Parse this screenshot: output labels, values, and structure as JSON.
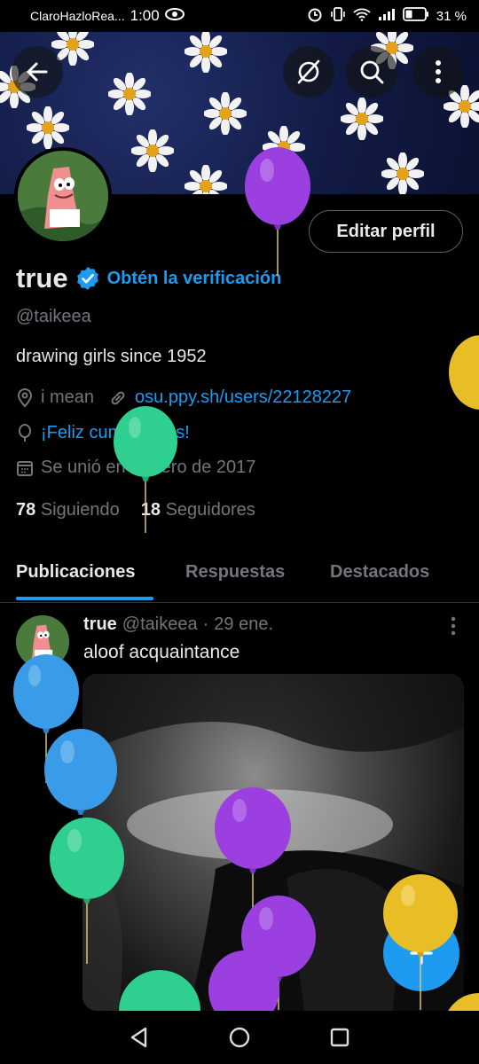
{
  "status_bar": {
    "carrier": "ClaroHazloRea...",
    "time": "1:00",
    "battery": "31 %",
    "icons": [
      "eye-icon",
      "alarm-icon",
      "vibrate-icon",
      "wifi-icon",
      "signal-icon",
      "battery-icon"
    ]
  },
  "header": {
    "icons": [
      "back-arrow-icon",
      "slashed-circle-icon",
      "search-icon",
      "more-vertical-icon"
    ]
  },
  "profile": {
    "edit_button": "Editar perfil",
    "display_name": "true",
    "verify_link": "Obtén la verificación",
    "handle": "@taikeea",
    "bio": "drawing girls since 1952",
    "location": "i mean",
    "website": "osu.ppy.sh/users/22128227",
    "birthday": "¡Feliz cumpleaños!",
    "joined": "Se unió en febrero de 2017",
    "following_count": "78",
    "following_label": "Siguiendo",
    "followers_count": "18",
    "followers_label": "Seguidores"
  },
  "tabs": [
    {
      "label": "Publicaciones",
      "active": true
    },
    {
      "label": "Respuestas",
      "active": false
    },
    {
      "label": "Destacados",
      "active": false
    }
  ],
  "post": {
    "name": "true",
    "handle": "@taikeea",
    "separator": "·",
    "date": "29 ene.",
    "text": "aloof acquaintance"
  },
  "fab": {
    "icon": "compose-plus-icon"
  },
  "nav_bar": {
    "icons": [
      "back-triangle-icon",
      "home-circle-icon",
      "recents-square-icon"
    ]
  },
  "colors": {
    "accent": "#1d9bf0",
    "background": "#000000",
    "text_primary": "#e7e9ea",
    "text_secondary": "#71767b",
    "balloon_purple": "#9b3fe0",
    "balloon_green": "#2fcf8f",
    "balloon_blue": "#3a9be8",
    "balloon_yellow": "#e9bd25"
  }
}
